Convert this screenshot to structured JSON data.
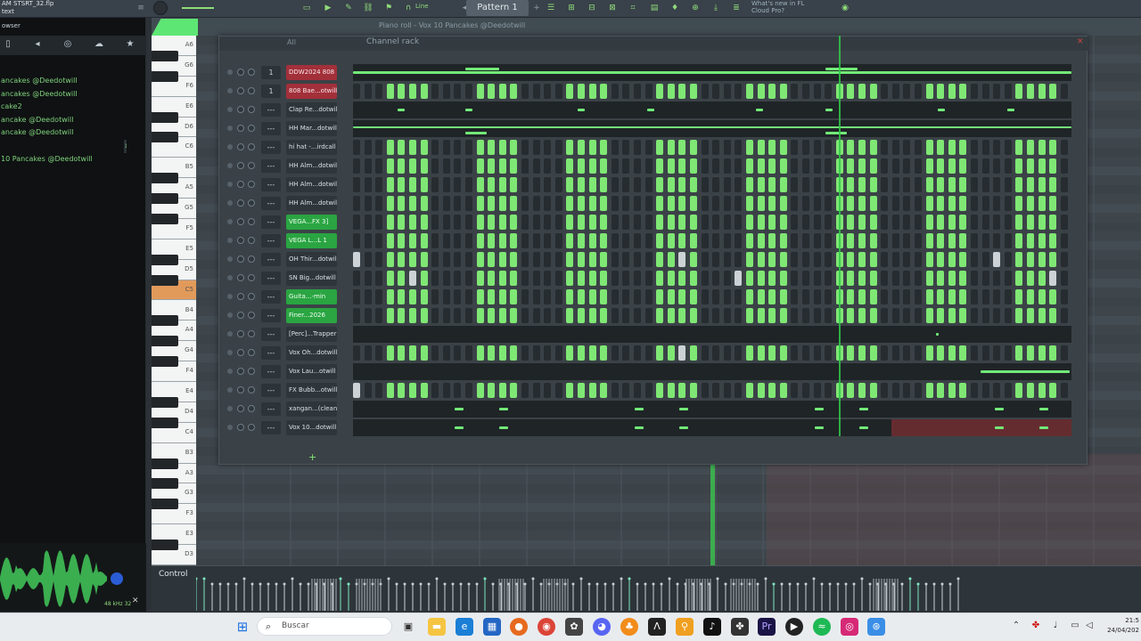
{
  "topbar": {
    "filename": "AM STSRT_32.flp",
    "subtitle": "text",
    "pattern": "Pattern 1",
    "snap": "Line",
    "news": "What's new in FL",
    "news2": "Cloud Pro?"
  },
  "browser": {
    "header": "owser",
    "items": [
      "ancakes @Deedotwill",
      "ancakes @Deedotwill",
      "cake2",
      "ancake @Deedotwill",
      "ancake @Deedotwill",
      "x 10 Pancakes @Deedotwill",
      "10 Pancakes @Deedotwill"
    ],
    "selected_index": 5,
    "samplerate": "48 kHz 32"
  },
  "pianoroll": {
    "title": "Piano roll - Vox 10 Pancakes @Deedotwill",
    "control_label": "Control"
  },
  "piano_keys": [
    "A6",
    "G6",
    "F6",
    "E6",
    "D6",
    "C6",
    "B5",
    "A5",
    "G5",
    "F5",
    "E5",
    "D5",
    "C5",
    "B4",
    "A4",
    "G4",
    "F4",
    "E4",
    "D4",
    "C4",
    "B3",
    "A3",
    "G3",
    "F3",
    "E3",
    "D3"
  ],
  "channelrack": {
    "title": "Channel rack",
    "filter": "All",
    "add": "+",
    "channels": [
      {
        "mix": "1",
        "name": "DDW2024 808 1",
        "style": "red",
        "mode": "notes"
      },
      {
        "mix": "1",
        "name": "808 Bae...otwill",
        "style": "red",
        "mode": "steps"
      },
      {
        "mix": "---",
        "name": "Clap Re...dotwill",
        "style": "",
        "mode": "notes"
      },
      {
        "mix": "---",
        "name": "HH Mar...dotwill",
        "style": "",
        "mode": "notes"
      },
      {
        "mix": "---",
        "name": "hi hat -...irdcall",
        "style": "",
        "mode": "steps"
      },
      {
        "mix": "---",
        "name": "HH Alm...dotwill",
        "style": "",
        "mode": "steps"
      },
      {
        "mix": "---",
        "name": "HH Alm...dotwill",
        "style": "",
        "mode": "steps"
      },
      {
        "mix": "---",
        "name": "HH Alm...dotwill",
        "style": "",
        "mode": "steps"
      },
      {
        "mix": "---",
        "name": "VEGA...FX 3]",
        "style": "grn",
        "mode": "steps"
      },
      {
        "mix": "---",
        "name": "VEGA L...L 1",
        "style": "grn",
        "mode": "steps"
      },
      {
        "mix": "---",
        "name": "OH Thir...dotwill",
        "style": "",
        "mode": "steps"
      },
      {
        "mix": "---",
        "name": "SN Big...dotwill",
        "style": "",
        "mode": "steps"
      },
      {
        "mix": "---",
        "name": "Guita...-min",
        "style": "grn",
        "mode": "steps"
      },
      {
        "mix": "---",
        "name": "Finer...2026",
        "style": "grn",
        "mode": "steps"
      },
      {
        "mix": "---",
        "name": "[Perc]...Trapper",
        "style": "",
        "mode": "empty"
      },
      {
        "mix": "---",
        "name": "Vox Oh...dotwill",
        "style": "",
        "mode": "steps"
      },
      {
        "mix": "---",
        "name": "Vox Lau...otwill",
        "style": "",
        "mode": "notes"
      },
      {
        "mix": "---",
        "name": "FX Bubb...otwill",
        "style": "",
        "mode": "steps"
      },
      {
        "mix": "---",
        "name": "xangan...(clean)",
        "style": "",
        "mode": "notes"
      },
      {
        "mix": "---",
        "name": "Vox 10...dotwill",
        "style": "",
        "mode": "notes"
      }
    ]
  },
  "taskbar": {
    "search": "Buscar",
    "time": "21:5",
    "date": "24/04/202"
  }
}
